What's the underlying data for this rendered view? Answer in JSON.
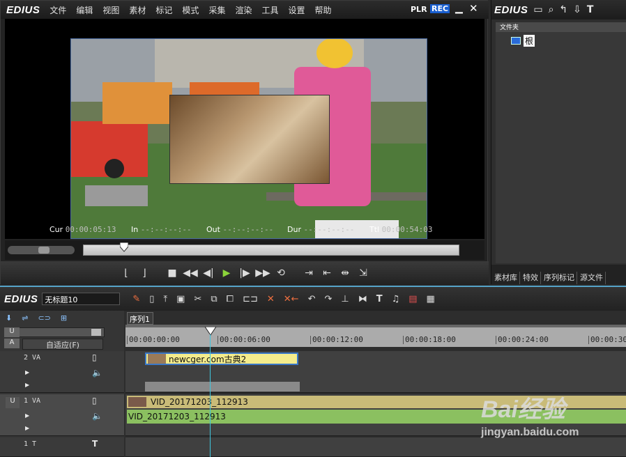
{
  "player": {
    "app_name": "EDIUS",
    "menu": [
      "文件",
      "编辑",
      "视图",
      "素材",
      "标记",
      "模式",
      "采集",
      "渲染",
      "工具",
      "设置",
      "帮助"
    ],
    "plr_label": "PLR",
    "rec_label": "REC",
    "timecodes": {
      "cur_label": "Cur",
      "cur_value": "00:00:05:13",
      "in_label": "In",
      "in_value": "--:--:--:--",
      "out_label": "Out",
      "out_value": "--:--:--:--",
      "dur_label": "Dur",
      "dur_value": "--:--:--:--",
      "ttl_label": "Ttl",
      "ttl_value": "00:00:54:03"
    },
    "playhead_fraction": 0.11
  },
  "bin": {
    "app_name": "EDIUS",
    "folder_header": "文件夹",
    "root_label": "根",
    "tabs": [
      "素材库",
      "特效",
      "序列标记",
      "源文件"
    ]
  },
  "timeline": {
    "app_name": "EDIUS",
    "project_title": "无标题10",
    "sequence_tab": "序列1",
    "fit_label": "自适应(F)",
    "ruler_ticks": [
      "00:00:00:00",
      "00:00:06:00",
      "00:00:12:00",
      "00:00:18:00",
      "00:00:24:00",
      "00:00:30"
    ],
    "tracks": [
      {
        "name": "2 VA",
        "clips": [
          {
            "label": "newcger.com古典2"
          }
        ]
      },
      {
        "name": "1 VA",
        "clips": [
          {
            "label": "VID_20171203_112913"
          },
          {
            "label": "VID_20171203_112913"
          }
        ]
      },
      {
        "name": "1 T"
      }
    ]
  },
  "watermark": {
    "brand": "Bai经验",
    "url": "jingyan.baidu.com"
  },
  "colors": {
    "accent": "#55a3c8",
    "rec": "#1a5fd0",
    "video_clip": "#c9bb78",
    "audio_clip": "#8bc060",
    "title_clip": "#f4ec8c"
  }
}
